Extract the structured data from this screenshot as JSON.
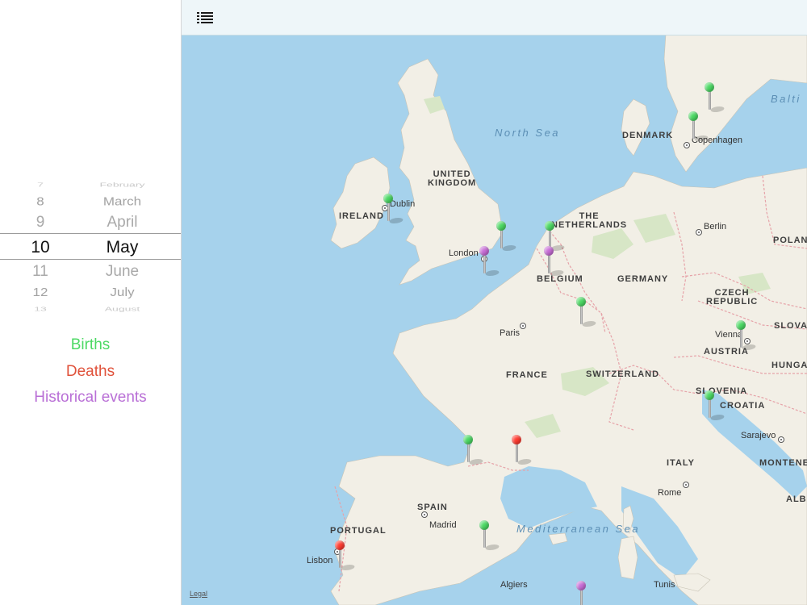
{
  "picker": {
    "rows": [
      {
        "day": "7",
        "month": "February"
      },
      {
        "day": "8",
        "month": "March"
      },
      {
        "day": "9",
        "month": "April"
      },
      {
        "day": "10",
        "month": "May"
      },
      {
        "day": "11",
        "month": "June"
      },
      {
        "day": "12",
        "month": "July"
      },
      {
        "day": "13",
        "month": "August"
      }
    ],
    "selected_day": "10",
    "selected_month": "May"
  },
  "legend": {
    "births": {
      "label": "Births",
      "color": "#4cd964"
    },
    "deaths": {
      "label": "Deaths",
      "color": "#e0523b"
    },
    "events": {
      "label": "Historical events",
      "color": "#b96fd6"
    }
  },
  "toolbar": {
    "list_icon": "list-icon"
  },
  "map": {
    "countries": {
      "uk": "UNITED\nKINGDOM",
      "ireland": "IRELAND",
      "netherlands": "THE\nNETHERLANDS",
      "denmark": "DENMARK",
      "belgium": "BELGIUM",
      "germany": "GERMANY",
      "poland": "POLAN",
      "czech": "CZECH\nREPUBLIC",
      "slovakia": "SLOVA",
      "austria": "AUSTRIA",
      "hungary": "HUNGA",
      "france": "FRANCE",
      "switzerland": "SWITZERLAND",
      "slovenia": "SLOVENIA",
      "croatia": "CROATIA",
      "italy": "ITALY",
      "montenegro": "MONTENE",
      "albania": "ALB",
      "spain": "SPAIN",
      "portugal": "PORTUGAL"
    },
    "cities": {
      "dublin": "Dublin",
      "london": "London",
      "copenhagen": "Copenhagen",
      "berlin": "Berlin",
      "paris": "Paris",
      "vienna": "Vienna",
      "sarajevo": "Sarajevo",
      "rome": "Rome",
      "madrid": "Madrid",
      "lisbon": "Lisbon",
      "algiers": "Algiers",
      "tunis": "Tunis"
    },
    "seas": {
      "north_sea": "North Sea",
      "baltic": "Balti",
      "mediterranean": "Mediterranean Sea"
    },
    "legal": "Legal",
    "pin_colors": {
      "green": "#4cd964",
      "red": "#ff3b30",
      "purple": "#c86dd7"
    }
  }
}
